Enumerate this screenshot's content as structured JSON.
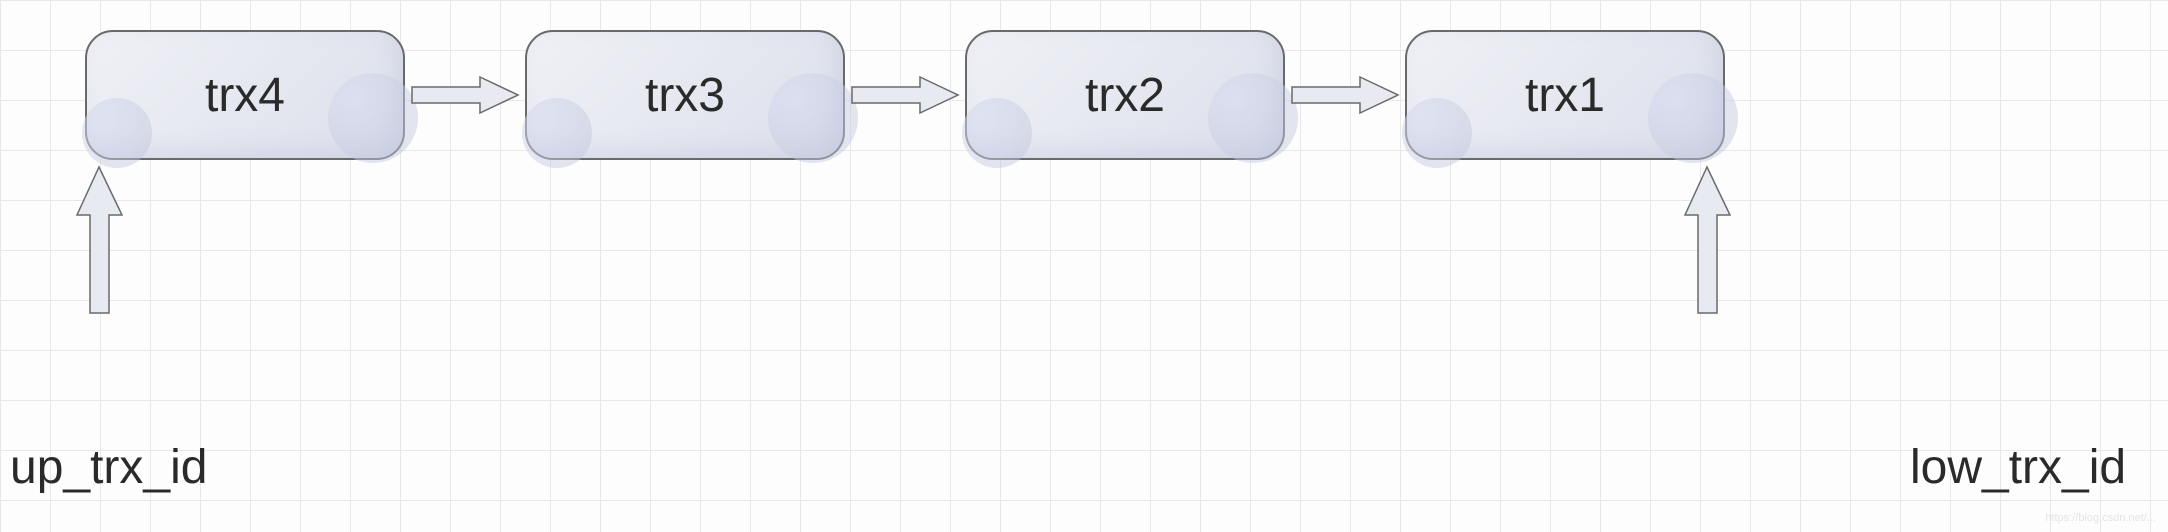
{
  "nodes": {
    "n0": {
      "label": "trx4"
    },
    "n1": {
      "label": "trx3"
    },
    "n2": {
      "label": "trx2"
    },
    "n3": {
      "label": "trx1"
    }
  },
  "labels": {
    "left": "up_trx_id",
    "right": "low_trx_id"
  },
  "watermark": "https://blog.csdn.net/..."
}
